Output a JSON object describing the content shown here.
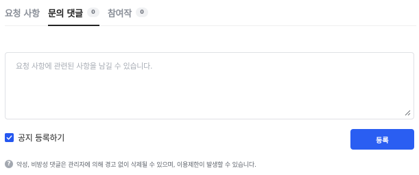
{
  "tabs": [
    {
      "label": "요청 사항",
      "count": null,
      "active": false
    },
    {
      "label": "문의 댓글",
      "count": "0",
      "active": true
    },
    {
      "label": "참여작",
      "count": "0",
      "active": false
    }
  ],
  "comment_form": {
    "placeholder": "요청 사항에 관련된 사항을 남길 수 있습니다.",
    "value": "",
    "notice_checkbox": {
      "label": "공지 등록하기",
      "checked": true
    },
    "submit_label": "등록"
  },
  "warning": {
    "icon": "question-mark-icon",
    "icon_glyph": "?",
    "text": "악성, 비방성 댓글은 관리자에 의해 경고 없이 삭제될 수 있으며, 이용제한이 발생할 수 있습니다."
  },
  "colors": {
    "accent": "#2a5ef2",
    "active_tab": "#222222",
    "inactive_tab": "#8a8f98"
  }
}
